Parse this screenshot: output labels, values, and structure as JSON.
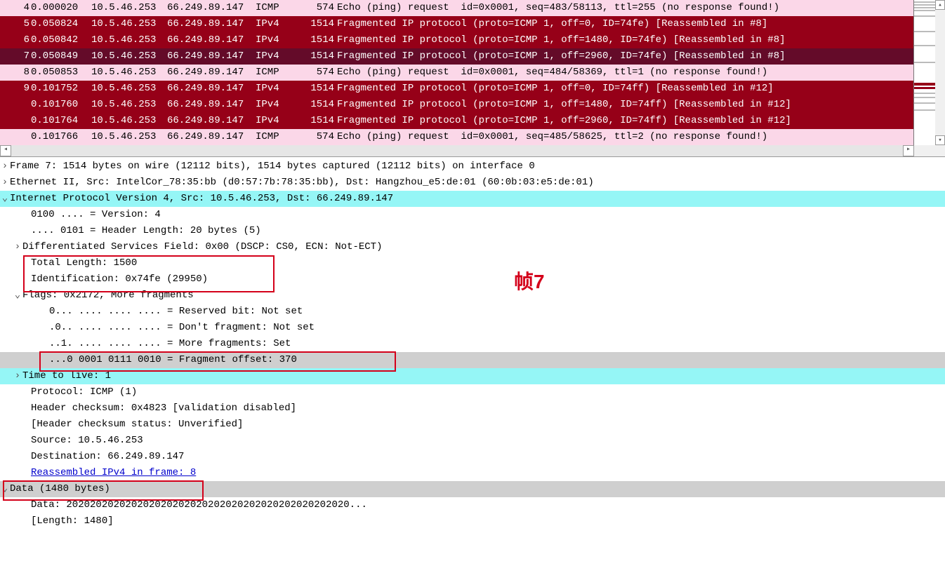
{
  "packets": [
    {
      "no": "4",
      "time": "0.000020",
      "src": "10.5.46.253",
      "dst": "66.249.89.147",
      "proto": "ICMP",
      "len": "574",
      "info": "Echo (ping) request  id=0x0001, seq=483/58113, ttl=255 (no response found!)",
      "cls": "icmp-row"
    },
    {
      "no": "5",
      "time": "0.050824",
      "src": "10.5.46.253",
      "dst": "66.249.89.147",
      "proto": "IPv4",
      "len": "1514",
      "info": "Fragmented IP protocol (proto=ICMP 1, off=0, ID=74fe) [Reassembled in #8]",
      "cls": "ipv4-row"
    },
    {
      "no": "6",
      "time": "0.050842",
      "src": "10.5.46.253",
      "dst": "66.249.89.147",
      "proto": "IPv4",
      "len": "1514",
      "info": "Fragmented IP protocol (proto=ICMP 1, off=1480, ID=74fe) [Reassembled in #8]",
      "cls": "ipv4-row"
    },
    {
      "no": "7",
      "time": "0.050849",
      "src": "10.5.46.253",
      "dst": "66.249.89.147",
      "proto": "IPv4",
      "len": "1514",
      "info": "Fragmented IP protocol (proto=ICMP 1, off=2960, ID=74fe) [Reassembled in #8]",
      "cls": "sel-row"
    },
    {
      "no": "8",
      "time": "0.050853",
      "src": "10.5.46.253",
      "dst": "66.249.89.147",
      "proto": "ICMP",
      "len": "574",
      "info": "Echo (ping) request  id=0x0001, seq=484/58369, ttl=1 (no response found!)",
      "cls": "icmp-row"
    },
    {
      "no": "9",
      "time": "0.101752",
      "src": "10.5.46.253",
      "dst": "66.249.89.147",
      "proto": "IPv4",
      "len": "1514",
      "info": "Fragmented IP protocol (proto=ICMP 1, off=0, ID=74ff) [Reassembled in #12]",
      "cls": "ipv4-row"
    },
    {
      "no": "",
      "time": "0.101760",
      "src": "10.5.46.253",
      "dst": "66.249.89.147",
      "proto": "IPv4",
      "len": "1514",
      "info": "Fragmented IP protocol (proto=ICMP 1, off=1480, ID=74ff) [Reassembled in #12]",
      "cls": "ipv4-row"
    },
    {
      "no": "",
      "time": "0.101764",
      "src": "10.5.46.253",
      "dst": "66.249.89.147",
      "proto": "IPv4",
      "len": "1514",
      "info": "Fragmented IP protocol (proto=ICMP 1, off=2960, ID=74ff) [Reassembled in #12]",
      "cls": "ipv4-row"
    },
    {
      "no": "",
      "time": "0.101766",
      "src": "10.5.46.253",
      "dst": "66.249.89.147",
      "proto": "ICMP",
      "len": "574",
      "info": "Echo (ping) request  id=0x0001, seq=485/58625, ttl=2 (no response found!)",
      "cls": "icmp-row"
    }
  ],
  "d": {
    "frame": "Frame 7: 1514 bytes on wire (12112 bits), 1514 bytes captured (12112 bits) on interface 0",
    "eth": "Ethernet II, Src: IntelCor_78:35:bb (d0:57:7b:78:35:bb), Dst: Hangzhou_e5:de:01 (60:0b:03:e5:de:01)",
    "ip": "Internet Protocol Version 4, Src: 10.5.46.253, Dst: 66.249.89.147",
    "ver": "0100 .... = Version: 4",
    "hl": ".... 0101 = Header Length: 20 bytes (5)",
    "dscp": "Differentiated Services Field: 0x00 (DSCP: CS0, ECN: Not-ECT)",
    "tl": "Total Length: 1500",
    "id": "Identification: 0x74fe (29950)",
    "flags": "Flags: 0x2172, More fragments",
    "rb": "0... .... .... .... = Reserved bit: Not set",
    "df": ".0.. .... .... .... = Don't fragment: Not set",
    "mf": "..1. .... .... .... = More fragments: Set",
    "fo": "...0 0001 0111 0010 = Fragment offset: 370",
    "ttl": "Time to live: 1",
    "protoicmp": "Protocol: ICMP (1)",
    "hcs": "Header checksum: 0x4823 [validation disabled]",
    "hcss": "[Header checksum status: Unverified]",
    "srcip": "Source: 10.5.46.253",
    "dstip": "Destination: 66.249.89.147",
    "reas": "Reassembled IPv4 in frame: 8",
    "data": "Data (1480 bytes)",
    "databytes": "Data: 202020202020202020202020202020202020202020202020...",
    "datalen": "[Length: 1480]"
  },
  "annot": "帧7"
}
